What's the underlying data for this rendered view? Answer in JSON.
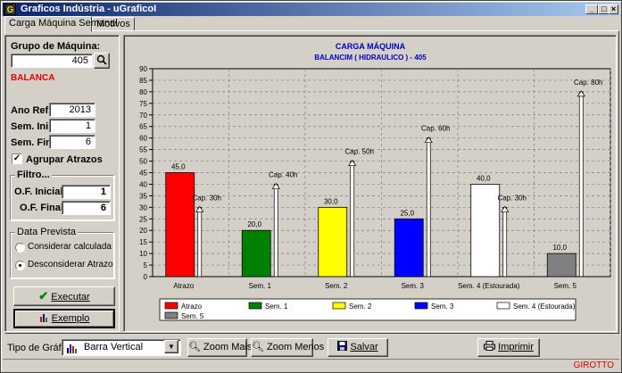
{
  "window": {
    "title": "Graficos Indústria - uGraficoI",
    "app_icon": "G"
  },
  "tabs": [
    {
      "label": "Carga Máquina Semanal"
    },
    {
      "label": "Motivos"
    }
  ],
  "left": {
    "grupo_label": "Grupo de Máquina:",
    "grupo_value": "405",
    "grupo_name": "BALANCA",
    "ano_label": "Ano Ref.:",
    "ano_value": "2013",
    "sem_ini_label": "Sem. Ini.:",
    "sem_ini_value": "1",
    "sem_fin_label": "Sem. Fin.:",
    "sem_fin_value": "6",
    "agrupar_label": "Agrupar Atrazos",
    "agrupar_checked": true,
    "filtro_title": "Filtro...",
    "of_inicial_label": "O.F. Inicial:",
    "of_inicial_value": "1",
    "of_final_label": "O.F. Final:",
    "of_final_value": "6",
    "data_prevista_title": "Data Prevista",
    "opt_calculada": "Considerar calculada",
    "opt_desconsiderar": "Desconsiderar Atrazo",
    "executar_label": "Executar",
    "exemplo_label": "Exemplo"
  },
  "chart_data": {
    "type": "bar",
    "title": "CARGA MÁQUINA",
    "subtitle": "BALANCIM ( HIDRAULICO ) - 405",
    "categories": [
      "Atrazo",
      "Sem. 1",
      "Sem. 2",
      "Sem. 3",
      "Sem. 4 (Estourada)",
      "Sem. 5"
    ],
    "values": [
      45.0,
      20.0,
      30.0,
      25.0,
      40.0,
      10.0
    ],
    "value_labels": [
      "45,0",
      "20,0",
      "30,0",
      "25,0",
      "40,0",
      "10,0"
    ],
    "colors": [
      "#ff0000",
      "#008000",
      "#ffff00",
      "#0000ff",
      "#ffffff",
      "#808080"
    ],
    "capacity": [
      30,
      40,
      50,
      60,
      30,
      80
    ],
    "capacity_labels": [
      "Cap. 30h",
      "Cap. 40h",
      "Cap. 50h",
      "Cap. 60h",
      "Cap. 30h",
      "Cap. 80h"
    ],
    "ylim": [
      0,
      90
    ],
    "yticks": [
      0,
      5,
      10,
      15,
      20,
      25,
      30,
      35,
      40,
      45,
      50,
      55,
      60,
      65,
      70,
      75,
      80,
      85,
      90
    ],
    "legend": [
      "Atrazo",
      "Sem. 1",
      "Sem. 2",
      "Sem. 3",
      "Sem. 4 (Estourada)",
      "Sem. 5"
    ],
    "legend_position": "bottom",
    "grid": true
  },
  "bottom": {
    "tipo_label": "Tipo de Gráfico:",
    "tipo_value": "Barra Vertical",
    "zoom_mais": "Zoom Mais",
    "zoom_menos": "Zoom Menos",
    "salvar": "Salvar",
    "imprimir": "Imprimir"
  },
  "status": {
    "right": "GIROTTO"
  }
}
